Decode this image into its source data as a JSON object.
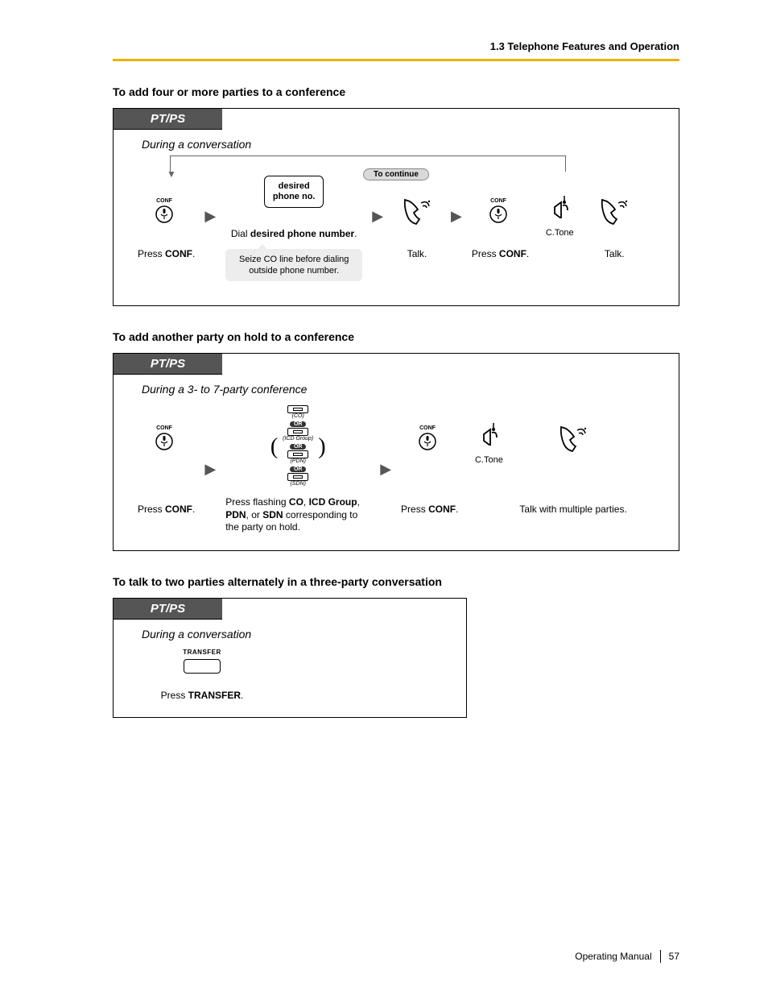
{
  "header": {
    "breadcrumb": "1.3 Telephone Features and Operation"
  },
  "section1": {
    "title": "To add four or more parties to a conference",
    "tab": "PT/PS",
    "context": "During a conversation",
    "to_continue": "To continue",
    "step1": {
      "btn": "CONF",
      "caption_pre": "Press ",
      "caption_bold": "CONF",
      "caption_post": "."
    },
    "step2": {
      "line1": "desired",
      "line2": "phone no.",
      "caption_pre": "Dial ",
      "caption_bold": "desired phone number",
      "caption_post": "."
    },
    "step3": {
      "caption": "Talk."
    },
    "step4": {
      "btn": "CONF",
      "caption_pre": "Press ",
      "caption_bold": "CONF",
      "caption_post": "."
    },
    "step5": {
      "label": "C.Tone"
    },
    "step6": {
      "caption": "Talk."
    },
    "note": "Seize CO line before dialing outside phone number."
  },
  "section2": {
    "title": "To add another party on hold to a conference",
    "tab": "PT/PS",
    "context": "During a 3- to 7-party conference",
    "step1": {
      "btn": "CONF",
      "caption_pre": "Press ",
      "caption_bold": "CONF",
      "caption_post": "."
    },
    "step2": {
      "opts": [
        "(CO)",
        "(ICD Group)",
        "(PDN)",
        "(SDN)"
      ],
      "or": "OR",
      "caption": "Press flashing CO, ICD Group, PDN, or SDN corresponding to the party on hold."
    },
    "step3": {
      "btn": "CONF",
      "caption_pre": "Press ",
      "caption_bold": "CONF",
      "caption_post": "."
    },
    "step4": {
      "label": "C.Tone"
    },
    "step5": {
      "caption": "Talk with multiple parties."
    }
  },
  "section3": {
    "title": "To talk to two parties alternately in a three-party conversation",
    "tab": "PT/PS",
    "context": "During a conversation",
    "step1": {
      "btn": "TRANSFER",
      "caption_pre": "Press ",
      "caption_bold": "TRANSFER",
      "caption_post": "."
    }
  },
  "footer": {
    "label": "Operating Manual",
    "page": "57"
  }
}
